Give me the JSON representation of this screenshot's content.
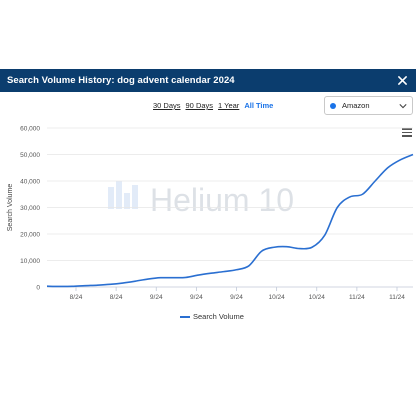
{
  "modal": {
    "title": "Search Volume History: dog advent calendar 2024",
    "close_label": "×"
  },
  "range_options": [
    {
      "label": "30 Days",
      "active": false
    },
    {
      "label": "90 Days",
      "active": false
    },
    {
      "label": "1 Year",
      "active": false
    },
    {
      "label": "All Time",
      "active": true
    }
  ],
  "marketplace": {
    "label": "Amazon",
    "dot_color": "#1a73e8"
  },
  "watermark": {
    "text": "Helium 10"
  },
  "legend": {
    "label": "Search Volume"
  },
  "chart_data": {
    "type": "line",
    "xlabel": "",
    "ylabel": "Search Volume",
    "ylim": [
      0,
      60000
    ],
    "y_ticks": [
      "0",
      "10,000",
      "20,000",
      "30,000",
      "40,000",
      "50,000",
      "60,000"
    ],
    "x_tick_labels": [
      "8/24",
      "8/24",
      "9/24",
      "9/24",
      "9/24",
      "10/24",
      "10/24",
      "11/24",
      "11/24"
    ],
    "grid": true,
    "color": "#2a6fd1",
    "series": [
      {
        "name": "Search Volume",
        "values": [
          300,
          200,
          250,
          500,
          700,
          1000,
          1500,
          2200,
          3000,
          3500,
          3500,
          3600,
          4500,
          5200,
          5800,
          6500,
          8000,
          13500,
          15000,
          15200,
          14500,
          15000,
          19500,
          30000,
          34000,
          35000,
          40000,
          45000,
          48000,
          50000
        ]
      }
    ]
  }
}
